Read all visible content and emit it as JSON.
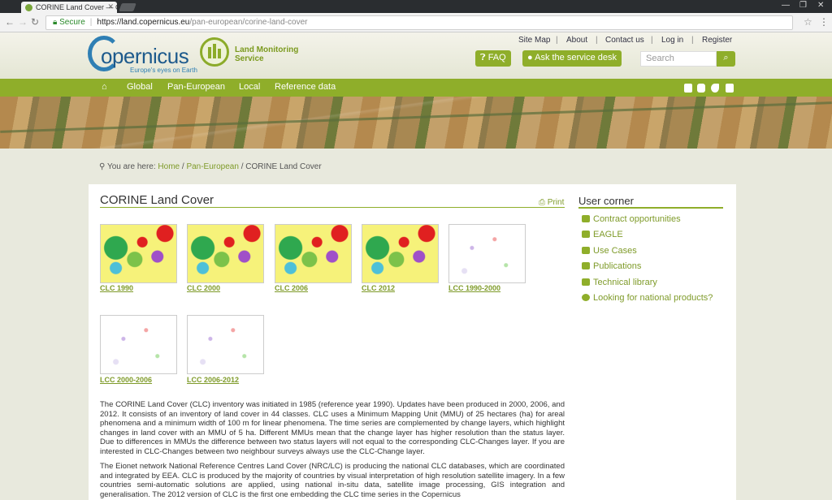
{
  "browser": {
    "tab_title": "CORINE Land Cover — C",
    "tab_close": "✕",
    "secure_label": "Secure",
    "url_host": "https://land.copernicus.eu",
    "url_path": "/pan-european/corine-land-cover",
    "win_min": "—",
    "win_restore": "❐",
    "win_close": "✕"
  },
  "header": {
    "logo_text": "opernicus",
    "logo_tagline": "Europe's eyes on Earth",
    "lms_line1": "Land Monitoring",
    "lms_line2": "Service",
    "top_links": [
      "Site Map",
      "About",
      "Contact us",
      "Log in",
      "Register"
    ],
    "faq_label": "FAQ",
    "service_desk_label": "Ask the service desk",
    "search_placeholder": "Search"
  },
  "nav": {
    "items": [
      "Global",
      "Pan-European",
      "Local",
      "Reference data"
    ]
  },
  "breadcrumb": {
    "prefix": "You are here:",
    "home": "Home",
    "sep": "/",
    "section": "Pan-European",
    "current": "CORINE Land Cover"
  },
  "content": {
    "title": "CORINE Land Cover",
    "print_label": "Print",
    "thumbnails": [
      {
        "label": "CLC 1990"
      },
      {
        "label": "CLC 2000"
      },
      {
        "label": "CLC 2006"
      },
      {
        "label": "CLC 2012"
      },
      {
        "label": "LCC 1990-2000"
      },
      {
        "label": "LCC 2000-2006"
      },
      {
        "label": "LCC 2006-2012"
      }
    ],
    "paragraph1": "The CORINE Land Cover (CLC) inventory was initiated in 1985 (reference year 1990). Updates have been produced in 2000, 2006, and 2012. It consists of an inventory of land cover in 44 classes. CLC uses a Minimum Mapping Unit (MMU) of 25 hectares (ha) for areal phenomena and a minimum width of 100 m for linear phenomena. The time series are complemented by change layers, which highlight changes in land cover with an MMU of 5 ha. Different MMUs mean that the change layer has higher resolution than the status layer. Due to differences in MMUs the difference between two status layers will not equal to the corresponding CLC-Changes layer. If you are interested in CLC-Changes between two neighbour surveys always use the CLC-Change layer.",
    "paragraph2": "The Eionet network National Reference Centres Land Cover (NRC/LC) is producing the national CLC databases, which are coordinated and integrated by EEA. CLC is produced by the majority of countries by visual interpretation of high resolution satellite imagery. In a few countries semi-automatic solutions are applied, using national in-situ data, satellite image processing, GIS integration and generalisation. The 2012 version of CLC is the first one embedding the CLC time series in the Copernicus"
  },
  "user_corner": {
    "title": "User corner",
    "items": [
      "Contract opportunities",
      "EAGLE",
      "Use Cases",
      "Publications",
      "Technical library",
      "Looking for national products?"
    ]
  },
  "colors": {
    "brand_green": "#8fae2a",
    "link_green": "#7f9b2a",
    "copernicus_blue": "#1d5a8c"
  }
}
